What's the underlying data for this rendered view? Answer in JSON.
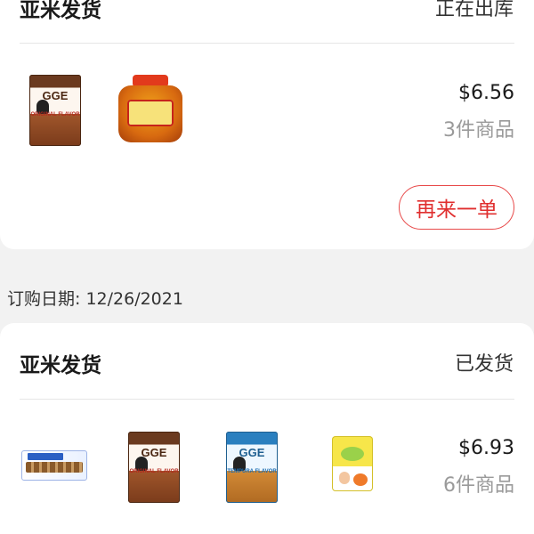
{
  "order1": {
    "seller": "亚米发货",
    "status": "正在出库",
    "price": "$6.56",
    "item_count": "3件商品",
    "reorder_label": "再来一单",
    "products": [
      {
        "icon": "gge-original-cracker-bag",
        "logo": "GGE",
        "flavor": "ORIGINAL FLAVOR"
      },
      {
        "icon": "chili-sauce-jar"
      }
    ]
  },
  "order2": {
    "date_label": "订购日期: 12/26/2021",
    "seller": "亚米发货",
    "status": "已发货",
    "price": "$6.93",
    "item_count": "6件商品",
    "products": [
      {
        "icon": "crackers-pack"
      },
      {
        "icon": "gge-original-cracker-bag",
        "logo": "GGE",
        "flavor": "ORIGINAL FLAVOR"
      },
      {
        "icon": "gge-tempura-cracker-bag",
        "logo": "GGE",
        "flavor": "TEMPURA FLAVOR"
      },
      {
        "icon": "yellow-snack-bag"
      }
    ]
  },
  "colors": {
    "accent_red": "#e02f2f",
    "highlight_pink": "#f6c7c8",
    "background": "#f2f2f2",
    "muted_text": "#9a9a9a"
  }
}
